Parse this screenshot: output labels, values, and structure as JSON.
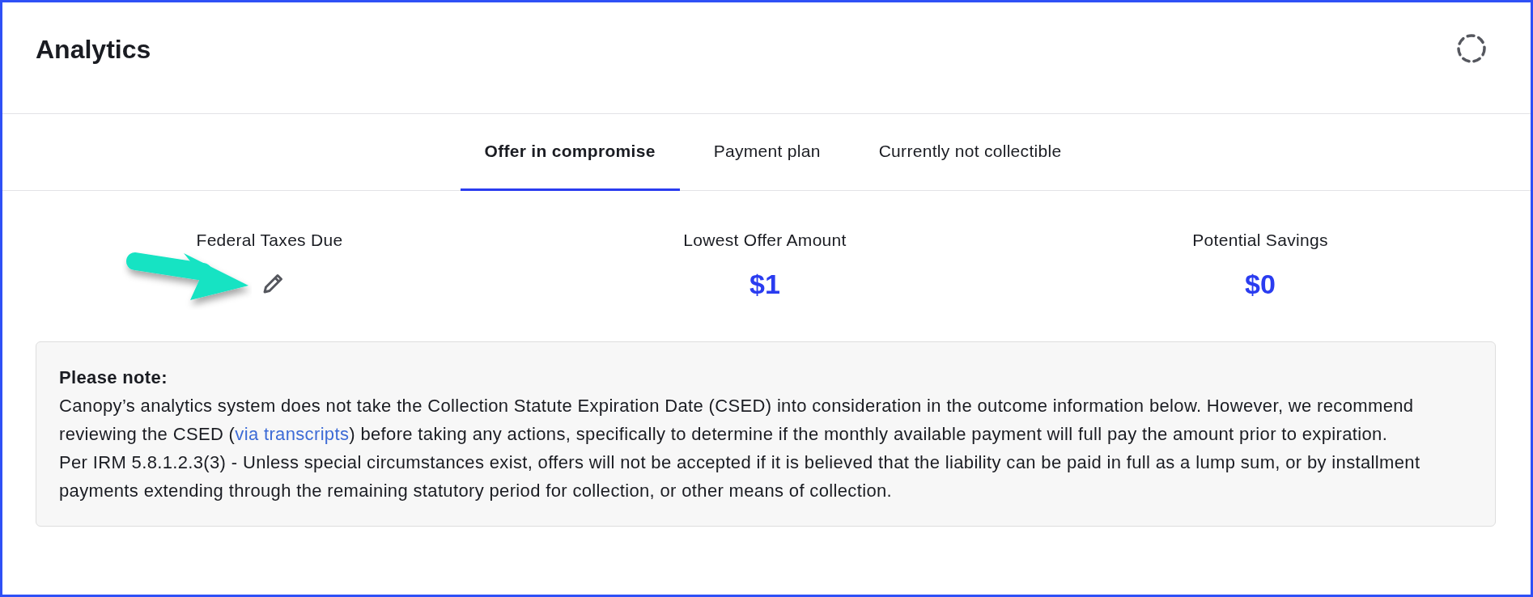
{
  "header": {
    "title": "Analytics",
    "loading": true
  },
  "tabs": [
    {
      "label": "Offer in compromise",
      "selected": true
    },
    {
      "label": "Payment plan",
      "selected": false
    },
    {
      "label": "Currently not collectible",
      "selected": false
    }
  ],
  "metrics": [
    {
      "kind": "edit",
      "label": "Federal Taxes Due"
    },
    {
      "kind": "value",
      "label": "Lowest Offer Amount",
      "value": "$1"
    },
    {
      "kind": "value",
      "label": "Potential Savings",
      "value": "$0"
    }
  ],
  "note": {
    "heading": "Please note:",
    "paragraphs": [
      {
        "before": "Canopy’s analytics system does not take the Collection Statute Expiration Date (CSED) into consideration in the outcome information below. However, we recommend reviewing the CSED (",
        "link": "via transcripts",
        "after": ") before taking any actions, specifically to determine if the monthly available payment will full pay the amount prior to expiration."
      },
      {
        "before": "Per IRM 5.8.1.2.3(3) - Unless special circumstances exist, offers will not be accepted if it is believed that the liability can be paid in full as a lump sum, or by installment payments extending through the remaining statutory period for collection, or other means of collection."
      }
    ]
  }
}
